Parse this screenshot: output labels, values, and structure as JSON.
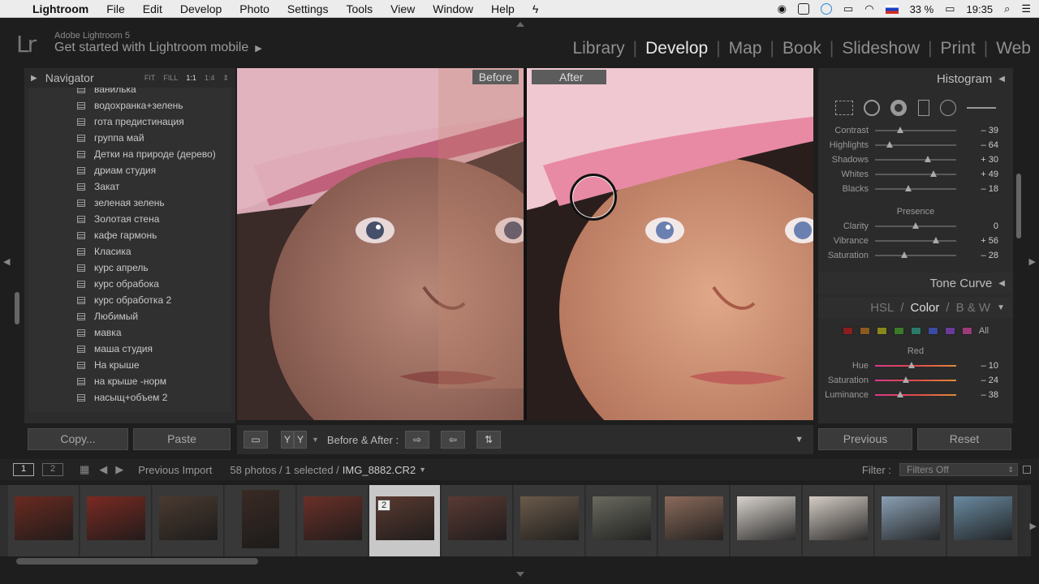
{
  "menubar": {
    "app": "Lightroom",
    "items": [
      "File",
      "Edit",
      "Develop",
      "Photo",
      "Settings",
      "Tools",
      "View",
      "Window",
      "Help"
    ],
    "battery": "33 %",
    "time": "19:35"
  },
  "identity": {
    "logo": "Lr",
    "line1": "Adobe Lightroom 5",
    "line2": "Get started with Lightroom mobile",
    "arrow": "▶"
  },
  "modules": {
    "items": [
      "Library",
      "Develop",
      "Map",
      "Book",
      "Slideshow",
      "Print",
      "Web"
    ],
    "active": "Develop"
  },
  "navigator": {
    "title": "Navigator",
    "zooms": [
      "FIT",
      "FILL",
      "1:1",
      "1:4"
    ]
  },
  "presets": [
    "ванилька",
    "водохранка+зелень",
    "гота предистинация",
    "группа май",
    "Детки на природе (дерево)",
    "дриам студия",
    "Закат",
    "зеленая зелень",
    "Золотая стена",
    "кафе гармонь",
    "Класика",
    "курс апрель",
    "курс обрабока",
    "курс обработка 2",
    "Любимый",
    "мавка",
    "маша студия",
    "На крыше",
    "на крыше -норм",
    "насыщ+объем 2"
  ],
  "left_buttons": {
    "copy": "Copy...",
    "paste": "Paste"
  },
  "view": {
    "before_label": "Before",
    "after_label": "After"
  },
  "toolbar": {
    "yy1": "Y",
    "yy2": "Y",
    "before_after": "Before & After :"
  },
  "right": {
    "histogram": "Histogram",
    "basic_rows": [
      {
        "label": "Contrast",
        "value": "– 39",
        "pos": 0.31
      },
      {
        "label": "Highlights",
        "value": "– 64",
        "pos": 0.18
      },
      {
        "label": "Shadows",
        "value": "+ 30",
        "pos": 0.65
      },
      {
        "label": "Whites",
        "value": "+ 49",
        "pos": 0.72
      },
      {
        "label": "Blacks",
        "value": "– 18",
        "pos": 0.41
      }
    ],
    "presence_title": "Presence",
    "presence_rows": [
      {
        "label": "Clarity",
        "value": "0",
        "pos": 0.5
      },
      {
        "label": "Vibrance",
        "value": "+ 56",
        "pos": 0.75
      },
      {
        "label": "Saturation",
        "value": "– 28",
        "pos": 0.36
      }
    ],
    "tone_curve": "Tone Curve",
    "hsl": "HSL",
    "color": "Color",
    "bw": "B & W",
    "swatch_colors": [
      "#8a1e1e",
      "#8a5a1e",
      "#8a861e",
      "#3c7a2a",
      "#2a7a6a",
      "#3a4aa0",
      "#6a3a9a",
      "#9a3a7a"
    ],
    "all": "All",
    "red_title": "Red",
    "red_rows": [
      {
        "label": "Hue",
        "value": "– 10",
        "pos": 0.45
      },
      {
        "label": "Saturation",
        "value": "– 24",
        "pos": 0.38
      },
      {
        "label": "Luminance",
        "value": "– 38",
        "pos": 0.31
      }
    ]
  },
  "right_buttons": {
    "previous": "Previous",
    "reset": "Reset"
  },
  "filmbar": {
    "page1": "1",
    "page2": "2",
    "source": "Previous Import",
    "count": "58 photos / 1 selected /",
    "file": "IMG_8882.CR2",
    "filter_label": "Filter :",
    "filter_value": "Filters Off"
  },
  "filmstrip": {
    "selected_badge": "2",
    "thumbs": [
      {
        "c": "#6a2a20"
      },
      {
        "c": "#7a2a22"
      },
      {
        "c": "#4a3a30"
      },
      {
        "c": "#3a2a24",
        "portrait": true
      },
      {
        "c": "#6a3028"
      },
      {
        "c": "#5a3a30",
        "selected": true
      },
      {
        "c": "#5a3a34"
      },
      {
        "c": "#6a5a4a"
      },
      {
        "c": "#6a6a60"
      },
      {
        "c": "#8a6a5a"
      },
      {
        "c": "#d8d2cc"
      },
      {
        "c": "#d4ccc4"
      },
      {
        "c": "#8aa0b4"
      },
      {
        "c": "#6a8aa0"
      }
    ]
  }
}
